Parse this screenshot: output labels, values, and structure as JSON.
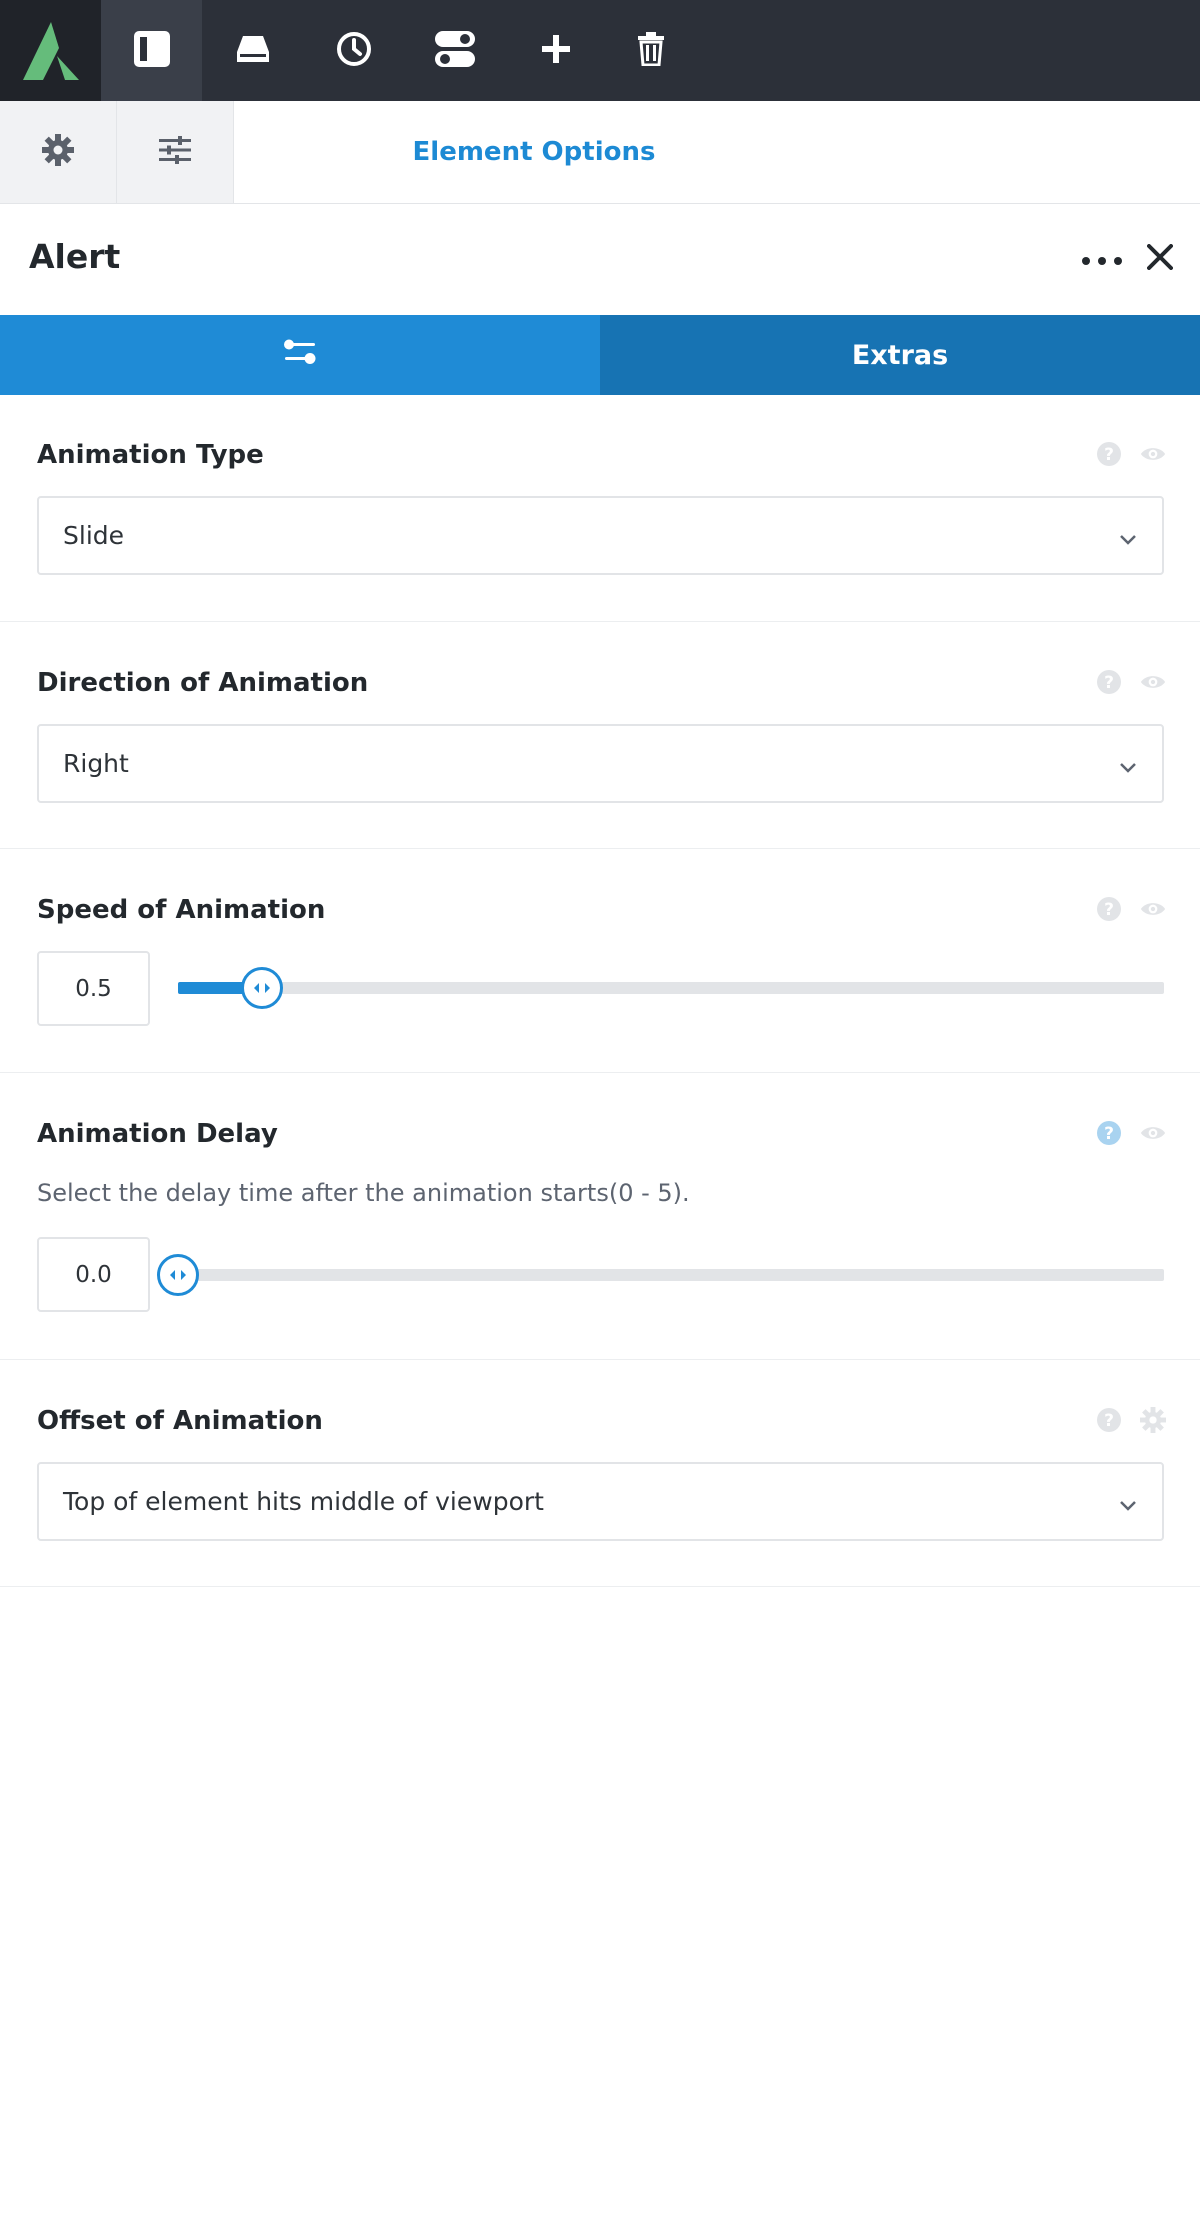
{
  "toolbar": {
    "logo_icon": "app-logo",
    "buttons": [
      {
        "name": "sidebar-toggle-icon",
        "active": true
      },
      {
        "name": "library-icon"
      },
      {
        "name": "history-icon"
      },
      {
        "name": "toggle-settings-icon"
      },
      {
        "name": "add-icon"
      },
      {
        "name": "trash-icon"
      }
    ],
    "colors": {
      "background": "#2c3039",
      "logo_green": "#65bc7b"
    }
  },
  "subheader": {
    "tabs": [
      {
        "icon": "gear-icon"
      },
      {
        "icon": "sliders-icon"
      }
    ],
    "title": "Element Options"
  },
  "element": {
    "title": "Alert",
    "more_icon": "ellipsis-icon",
    "close_icon": "close-icon"
  },
  "tabs": [
    {
      "icon": "sliders-icon",
      "label": ""
    },
    {
      "label": "Extras"
    }
  ],
  "options": {
    "animation_type": {
      "label": "Animation Type",
      "value": "Slide"
    },
    "direction": {
      "label": "Direction of Animation",
      "value": "Right"
    },
    "speed": {
      "label": "Speed of Animation",
      "value": "0.5",
      "min": 0,
      "max": 10,
      "fraction": 0.085
    },
    "delay": {
      "label": "Animation Delay",
      "description": "Select the delay time after the animation starts(0 - 5).",
      "value": "0.0",
      "min": 0,
      "max": 5,
      "fraction": 0.0
    },
    "offset": {
      "label": "Offset of Animation",
      "value": "Top of element hits middle of viewport"
    }
  },
  "colors": {
    "accent": "#1f8bd6",
    "accent_dark": "#1773b3",
    "title_link": "#1d8ad4"
  }
}
